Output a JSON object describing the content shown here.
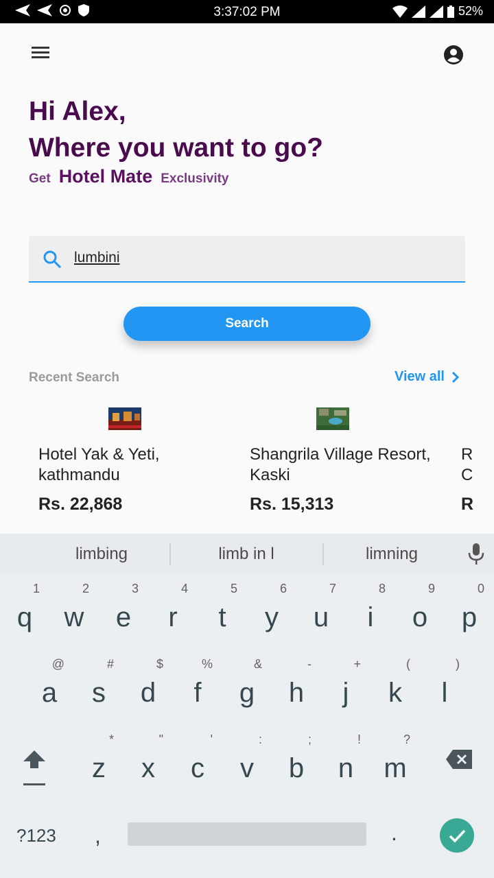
{
  "status_bar": {
    "time": "3:37:02 PM",
    "battery": "52%"
  },
  "greeting": {
    "line1": "Hi Alex,",
    "line2": "Where you want to go?",
    "tag_prefix": "Get",
    "brand": "Hotel Mate",
    "tag_suffix": "Exclusivity"
  },
  "search": {
    "value": "lumbini",
    "button_label": "Search"
  },
  "recent": {
    "label": "Recent Search",
    "view_all": "View all",
    "hotels": [
      {
        "name": "Hotel Yak & Yeti, kathmandu",
        "price": "Rs. 22,868"
      },
      {
        "name": "Shangrila Village Resort, Kaski",
        "price": "Rs. 15,313"
      }
    ]
  },
  "keyboard": {
    "suggestions": [
      "limbing",
      "limb in l",
      "limning"
    ],
    "row1": [
      {
        "k": "q",
        "h": "1"
      },
      {
        "k": "w",
        "h": "2"
      },
      {
        "k": "e",
        "h": "3"
      },
      {
        "k": "r",
        "h": "4"
      },
      {
        "k": "t",
        "h": "5"
      },
      {
        "k": "y",
        "h": "6"
      },
      {
        "k": "u",
        "h": "7"
      },
      {
        "k": "i",
        "h": "8"
      },
      {
        "k": "o",
        "h": "9"
      },
      {
        "k": "p",
        "h": "0"
      }
    ],
    "row2": [
      {
        "k": "a",
        "h": "@"
      },
      {
        "k": "s",
        "h": "#"
      },
      {
        "k": "d",
        "h": "$"
      },
      {
        "k": "f",
        "h": "%"
      },
      {
        "k": "g",
        "h": "&"
      },
      {
        "k": "h",
        "h": "-"
      },
      {
        "k": "j",
        "h": "+"
      },
      {
        "k": "k",
        "h": "("
      },
      {
        "k": "l",
        "h": ")"
      }
    ],
    "row3": [
      {
        "k": "z",
        "h": "*"
      },
      {
        "k": "x",
        "h": "\""
      },
      {
        "k": "c",
        "h": "'"
      },
      {
        "k": "v",
        "h": ":"
      },
      {
        "k": "b",
        "h": ";"
      },
      {
        "k": "n",
        "h": "!"
      },
      {
        "k": "m",
        "h": "?"
      }
    ],
    "symbols_key": "?123",
    "comma": ",",
    "period": "."
  },
  "colors": {
    "accent": "#2196f3",
    "heading": "#4a0a4e",
    "enter_key": "#39a995"
  }
}
